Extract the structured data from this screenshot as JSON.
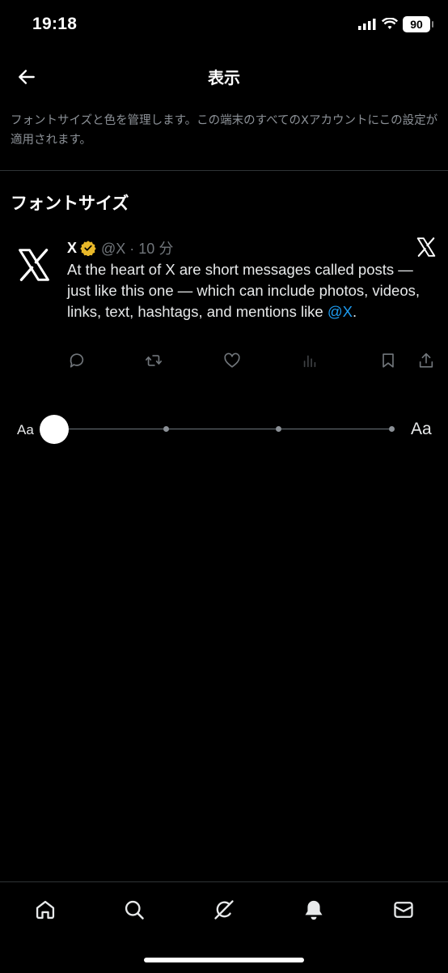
{
  "status_bar": {
    "time": "19:18",
    "battery": "90"
  },
  "header": {
    "title": "表示"
  },
  "description": "フォントサイズと色を管理します。この端末のすべてのXアカウントにこの設定が適用されます。",
  "section": {
    "title": "フォントサイズ"
  },
  "post": {
    "name": "X",
    "handle": "@X · 10 分",
    "text": "At the heart of X are short messages called posts — just like this one — which can include photos, videos, links, text, hashtags, and mentions like ",
    "mention": "@X",
    "text_end": "."
  },
  "font_slider": {
    "small_label": "Aa",
    "large_label": "Aa",
    "stops": 4,
    "selected_index": 0
  },
  "colors": {
    "accent": "#1d9bf0",
    "verified": "#e8b829",
    "background": "#000000"
  },
  "bottom_nav": [
    "home-icon",
    "search-icon",
    "grok-icon",
    "notifications-icon",
    "messages-icon"
  ]
}
